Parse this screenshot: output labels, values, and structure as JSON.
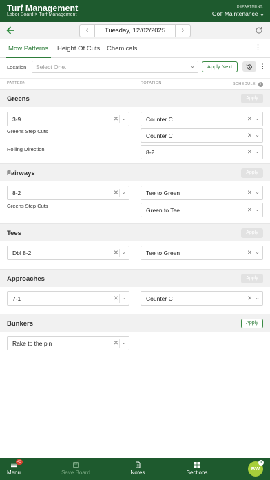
{
  "header": {
    "title": "Turf Management",
    "breadcrumb": [
      "Labor Board",
      "Turf Management"
    ],
    "breadcrumb_separator": ">",
    "department_label": "DEPARTMENT:",
    "department_value": "Golf Maintenance",
    "bg_color": "#1e5a2e"
  },
  "datebar": {
    "date": "Tuesday, 12/02/2025",
    "prev_icon": "chevron-left-icon",
    "next_icon": "chevron-right-icon",
    "refresh_icon": "refresh-icon"
  },
  "tabs": [
    {
      "label": "Mow Patterns",
      "active": true
    },
    {
      "label": "Height Of Cuts",
      "active": false
    },
    {
      "label": "Chemicals",
      "active": false
    }
  ],
  "location": {
    "label": "Location",
    "placeholder": "Select One..",
    "apply_next_label": "Apply Next"
  },
  "columns": {
    "pattern": "PATTERN",
    "rotation": "ROTATION",
    "schedule": "SCHEDULE"
  },
  "sections": {
    "greens": {
      "title": "Greens",
      "apply_label": "Apply",
      "pattern_value": "3-9",
      "rotation_value": "Counter C",
      "step_cuts_label": "Greens Step Cuts",
      "step_cuts_value": "Counter C",
      "rolling_label": "Rolling Direction",
      "rolling_value": "8-2"
    },
    "fairways": {
      "title": "Fairways",
      "apply_label": "Apply",
      "pattern_value": "8-2",
      "rotation_value": "Tee to Green",
      "step_cuts_label": "Greens Step Cuts",
      "step_cuts_value": "Green to Tee"
    },
    "tees": {
      "title": "Tees",
      "apply_label": "Apply",
      "pattern_value": "Dbl 8-2",
      "rotation_value": "Tee to Green"
    },
    "approaches": {
      "title": "Approaches",
      "apply_label": "Apply",
      "pattern_value": "7-1",
      "rotation_value": "Counter C"
    },
    "bunkers": {
      "title": "Bunkers",
      "apply_label": "Apply",
      "pattern_value": "Rake to the pin"
    }
  },
  "bottom_nav": {
    "menu_label": "Menu",
    "menu_badge": "43",
    "save_label": "Save Board",
    "notes_label": "Notes",
    "sections_label": "Sections",
    "avatar_initials": "BW",
    "avatar_badge": "1"
  },
  "colors": {
    "accent": "#2e7d3a",
    "avatar": "#a7cf3a",
    "badge": "#d9432f"
  }
}
